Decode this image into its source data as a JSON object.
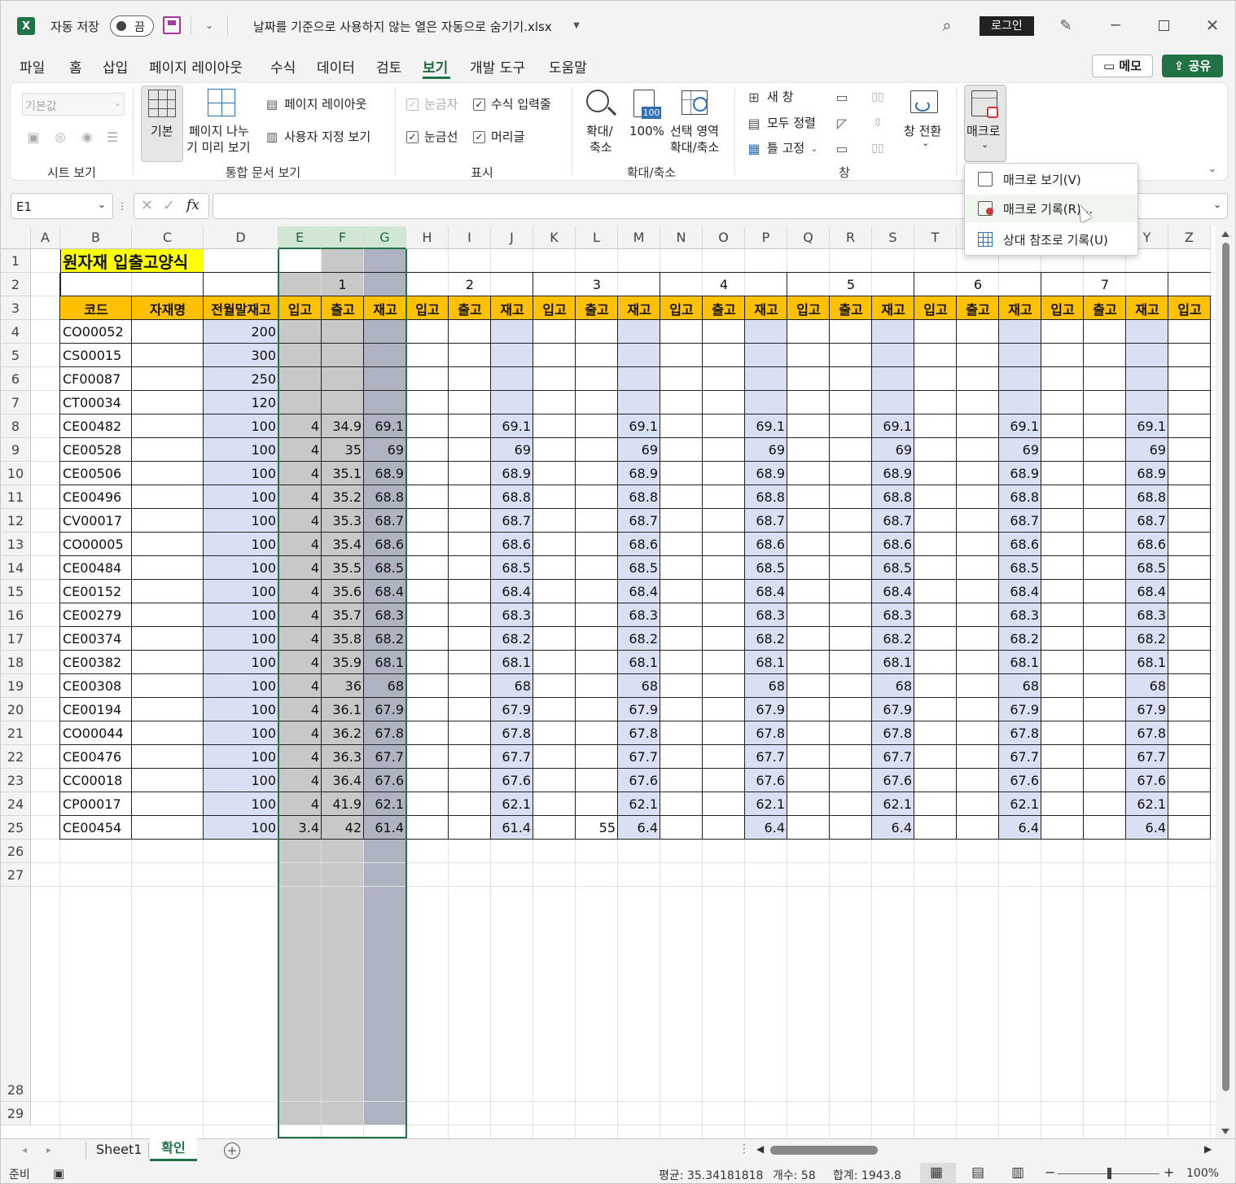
{
  "titlebar": {
    "autosave_label": "자동 저장",
    "autosave_state": "끔",
    "filename": "날짜를 기준으로 사용하지 않는 열은 자동으로 숨기기.xlsx",
    "login_button": "로그인"
  },
  "menu": {
    "tabs": [
      "파일",
      "홈",
      "삽입",
      "페이지 레이아웃",
      "수식",
      "데이터",
      "검토",
      "보기",
      "개발 도구",
      "도움말"
    ],
    "active": "보기",
    "memo_button": "메모",
    "share_button": "공유"
  },
  "ribbon": {
    "sheet_view": {
      "default_value": "기본값",
      "group": "시트 보기"
    },
    "workbook_views": {
      "normal": "기본",
      "page_break_line1": "페이지 나누",
      "page_break_line2": "기 미리 보기",
      "page_layout": "페이지 레이아웃",
      "custom_views": "사용자 지정 보기",
      "group": "통합 문서 보기"
    },
    "show": {
      "ruler": "눈금자",
      "formula_bar": "수식 입력줄",
      "gridlines": "눈금선",
      "headings": "머리글",
      "group": "표시"
    },
    "zoom": {
      "zoom_line1": "확대/",
      "zoom_line2": "축소",
      "hundred": "100%",
      "hundred_icon": "100",
      "sel_line1": "선택 영역",
      "sel_line2": "확대/축소",
      "group": "확대/축소"
    },
    "window": {
      "new_window": "새 창",
      "arrange_all": "모두 정렬",
      "freeze": "틀 고정",
      "switch": "창 전환",
      "group": "창"
    },
    "macros": {
      "label": "매크로"
    }
  },
  "macro_menu": {
    "items": [
      "매크로 보기(V)",
      "매크로 기록(R)...",
      "상대 참조로 기록(U)"
    ]
  },
  "formula_bar": {
    "name_box": "E1",
    "fx": "fx",
    "value": ""
  },
  "sheet": {
    "col_letters": [
      "A",
      "B",
      "C",
      "D",
      "E",
      "F",
      "G",
      "H",
      "I",
      "J",
      "K",
      "L",
      "M",
      "N",
      "O",
      "P",
      "Q",
      "R",
      "S",
      "T",
      "U",
      "V",
      "W",
      "X",
      "Y",
      "Z"
    ],
    "title": "원자재 입출고양식",
    "day_headers": [
      "1",
      "2",
      "3",
      "4",
      "5",
      "6",
      "7"
    ],
    "row3": [
      "코드",
      "자재명",
      "전월말재고",
      "입고",
      "출고",
      "재고",
      "입고",
      "출고",
      "재고",
      "입고",
      "출고",
      "재고",
      "입고",
      "출고",
      "재고",
      "입고",
      "출고",
      "재고",
      "입고",
      "출고",
      "재고",
      "입고",
      "출고",
      "재고",
      "입고"
    ],
    "row_numbers": [
      "1",
      "2",
      "3",
      "4",
      "5",
      "6",
      "7",
      "8",
      "9",
      "10",
      "11",
      "12",
      "13",
      "14",
      "15",
      "16",
      "17",
      "18",
      "19",
      "20",
      "21",
      "22",
      "23",
      "24",
      "25",
      "26",
      "27",
      "28",
      "29"
    ],
    "codes": [
      "CO00052",
      "CS00015",
      "CF00087",
      "CT00034",
      "CE00482",
      "CE00528",
      "CE00506",
      "CE00496",
      "CV00017",
      "CO00005",
      "CE00484",
      "CE00152",
      "CE00279",
      "CE00374",
      "CE00382",
      "CE00308",
      "CE00194",
      "CO00044",
      "CE00476",
      "CC00018",
      "CP00017",
      "CE00454"
    ],
    "prev_stock": [
      "200",
      "300",
      "250",
      "120",
      "100",
      "100",
      "100",
      "100",
      "100",
      "100",
      "100",
      "100",
      "100",
      "100",
      "100",
      "100",
      "100",
      "100",
      "100",
      "100",
      "100",
      "100"
    ],
    "in1": [
      "",
      "",
      "",
      "",
      "4",
      "4",
      "4",
      "4",
      "4",
      "4",
      "4",
      "4",
      "4",
      "4",
      "4",
      "4",
      "4",
      "4",
      "4",
      "4",
      "4",
      "3.4"
    ],
    "out1": [
      "",
      "",
      "",
      "",
      "34.9",
      "35",
      "35.1",
      "35.2",
      "35.3",
      "35.4",
      "35.5",
      "35.6",
      "35.7",
      "35.8",
      "35.9",
      "36",
      "36.1",
      "36.2",
      "36.3",
      "36.4",
      "41.9",
      "42"
    ],
    "stock1": [
      "",
      "",
      "",
      "",
      "69.1",
      "69",
      "68.9",
      "68.8",
      "68.7",
      "68.6",
      "68.5",
      "68.4",
      "68.3",
      "68.2",
      "68.1",
      "68",
      "67.9",
      "67.8",
      "67.7",
      "67.6",
      "62.1",
      "61.4"
    ],
    "stock2": [
      "",
      "",
      "",
      "",
      "69.1",
      "69",
      "68.9",
      "68.8",
      "68.7",
      "68.6",
      "68.5",
      "68.4",
      "68.3",
      "68.2",
      "68.1",
      "68",
      "67.9",
      "67.8",
      "67.7",
      "67.6",
      "62.1",
      "61.4"
    ],
    "stock_rest": [
      "",
      "",
      "",
      "",
      "69.1",
      "69",
      "68.9",
      "68.8",
      "68.7",
      "68.6",
      "68.5",
      "68.4",
      "68.3",
      "68.2",
      "68.1",
      "68",
      "67.9",
      "67.8",
      "67.7",
      "67.6",
      "62.1",
      "6.4"
    ],
    "l25_out": "55"
  },
  "tabs": {
    "sheets": [
      "Sheet1",
      "확인"
    ],
    "active": "확인"
  },
  "status": {
    "ready": "준비",
    "average": "평균: 35.34181818",
    "count": "개수: 58",
    "sum": "합계: 1943.8",
    "zoom": "100%"
  },
  "colors": {
    "excel_green": "#217346",
    "header_orange": "#ffc000",
    "title_yellow": "#ffff00",
    "light_blue": "#dae0f3",
    "selection_gray": "#c8c8c8"
  }
}
